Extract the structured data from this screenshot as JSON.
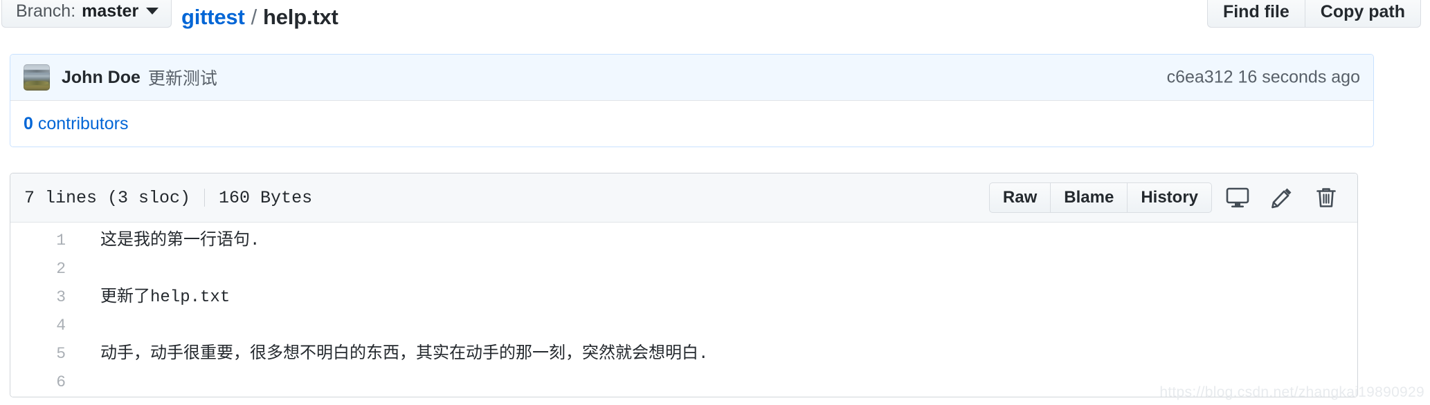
{
  "topbar": {
    "branch": {
      "label": "Branch:",
      "name": "master",
      "caret_icon": "chevron-down-icon"
    },
    "breadcrumb": {
      "repo": "gittest",
      "separator": "/",
      "file": "help.txt"
    },
    "actions": [
      {
        "label": "Find file"
      },
      {
        "label": "Copy path"
      }
    ]
  },
  "commit": {
    "avatar_icon": "avatar-photo",
    "author": "John Doe",
    "message": "更新测试",
    "hash": "c6ea312",
    "time": "16 seconds ago",
    "contributors_count": "0",
    "contributors_label": "contributors"
  },
  "file": {
    "lines_info": "7 lines (3 sloc)",
    "size_info": "160 Bytes",
    "buttons": [
      {
        "label": "Raw"
      },
      {
        "label": "Blame"
      },
      {
        "label": "History"
      }
    ],
    "icons": [
      {
        "name": "desktop-icon"
      },
      {
        "name": "pencil-icon"
      },
      {
        "name": "trash-icon"
      }
    ],
    "code_lines": [
      {
        "n": "1",
        "text": "这是我的第一行语句."
      },
      {
        "n": "2",
        "text": ""
      },
      {
        "n": "3",
        "text": "更新了help.txt"
      },
      {
        "n": "4",
        "text": ""
      },
      {
        "n": "5",
        "text": "动手，动手很重要，很多想不明白的东西，其实在动手的那一刻，突然就会想明白."
      },
      {
        "n": "6",
        "text": ""
      }
    ]
  },
  "watermark": "https://blog.csdn.net/zhangkai19890929",
  "colors": {
    "link": "#0366d6",
    "text": "#24292e",
    "muted": "#586069",
    "commit_header_bg": "#f1f8ff",
    "commit_border": "#c8e1ff",
    "file_header_bg": "#f6f8fa",
    "file_border": "#d1d5da"
  }
}
